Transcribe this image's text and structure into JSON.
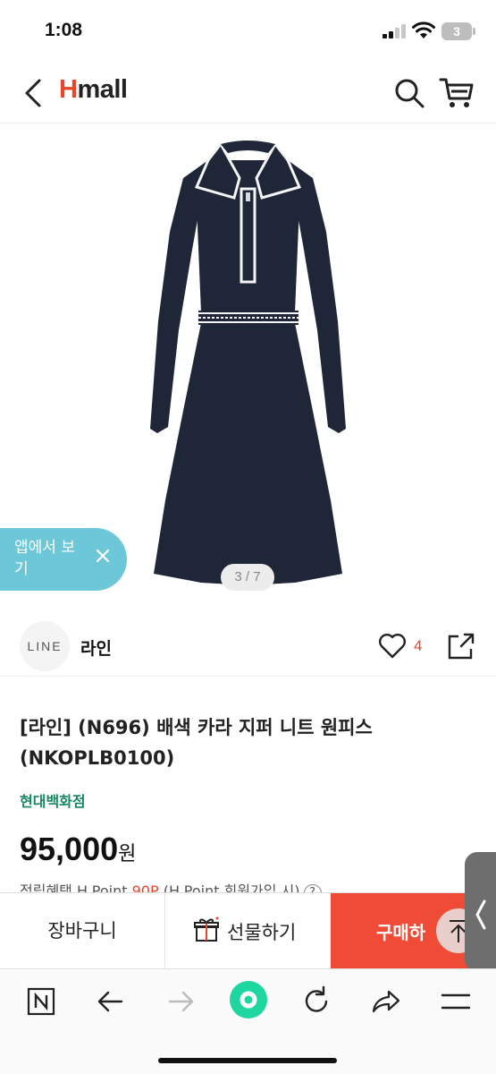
{
  "status_bar": {
    "time": "1:08",
    "battery": "3"
  },
  "header": {
    "logo_h": "H",
    "logo_rest": "mall"
  },
  "gallery": {
    "pager": "3 / 7"
  },
  "app_banner": {
    "text": "앱에서 보기"
  },
  "brand": {
    "logo": "LINE",
    "name": "라인",
    "like_count": "4"
  },
  "product": {
    "title": "[라인] (N696) 배색 카라 지퍼 니트 원피스 (NKOPLB0100)",
    "store": "현대백화점",
    "price": "95,000",
    "price_unit": "원",
    "point_prefix": "적립혜택 H.Point ",
    "point_value": "90P",
    "point_suffix": " (H.Point 회원가입 시)",
    "point_help": "?"
  },
  "actions": {
    "cart": "장바구니",
    "gift": "선물하기",
    "buy": "구매하"
  },
  "colors": {
    "brand_red": "#e9452b",
    "buy_button": "#f04b36",
    "banner": "#6cc8d9",
    "store_green": "#17875f",
    "dress_navy": "#1f2637"
  },
  "icons": [
    "back-icon",
    "search-icon",
    "cart-icon",
    "close-icon",
    "heart-icon",
    "share-icon",
    "gift-icon",
    "scroll-top-icon",
    "naver-icon",
    "browser-back-icon",
    "browser-forward-icon",
    "home-icon",
    "refresh-icon",
    "share-arrow-icon",
    "menu-icon"
  ]
}
